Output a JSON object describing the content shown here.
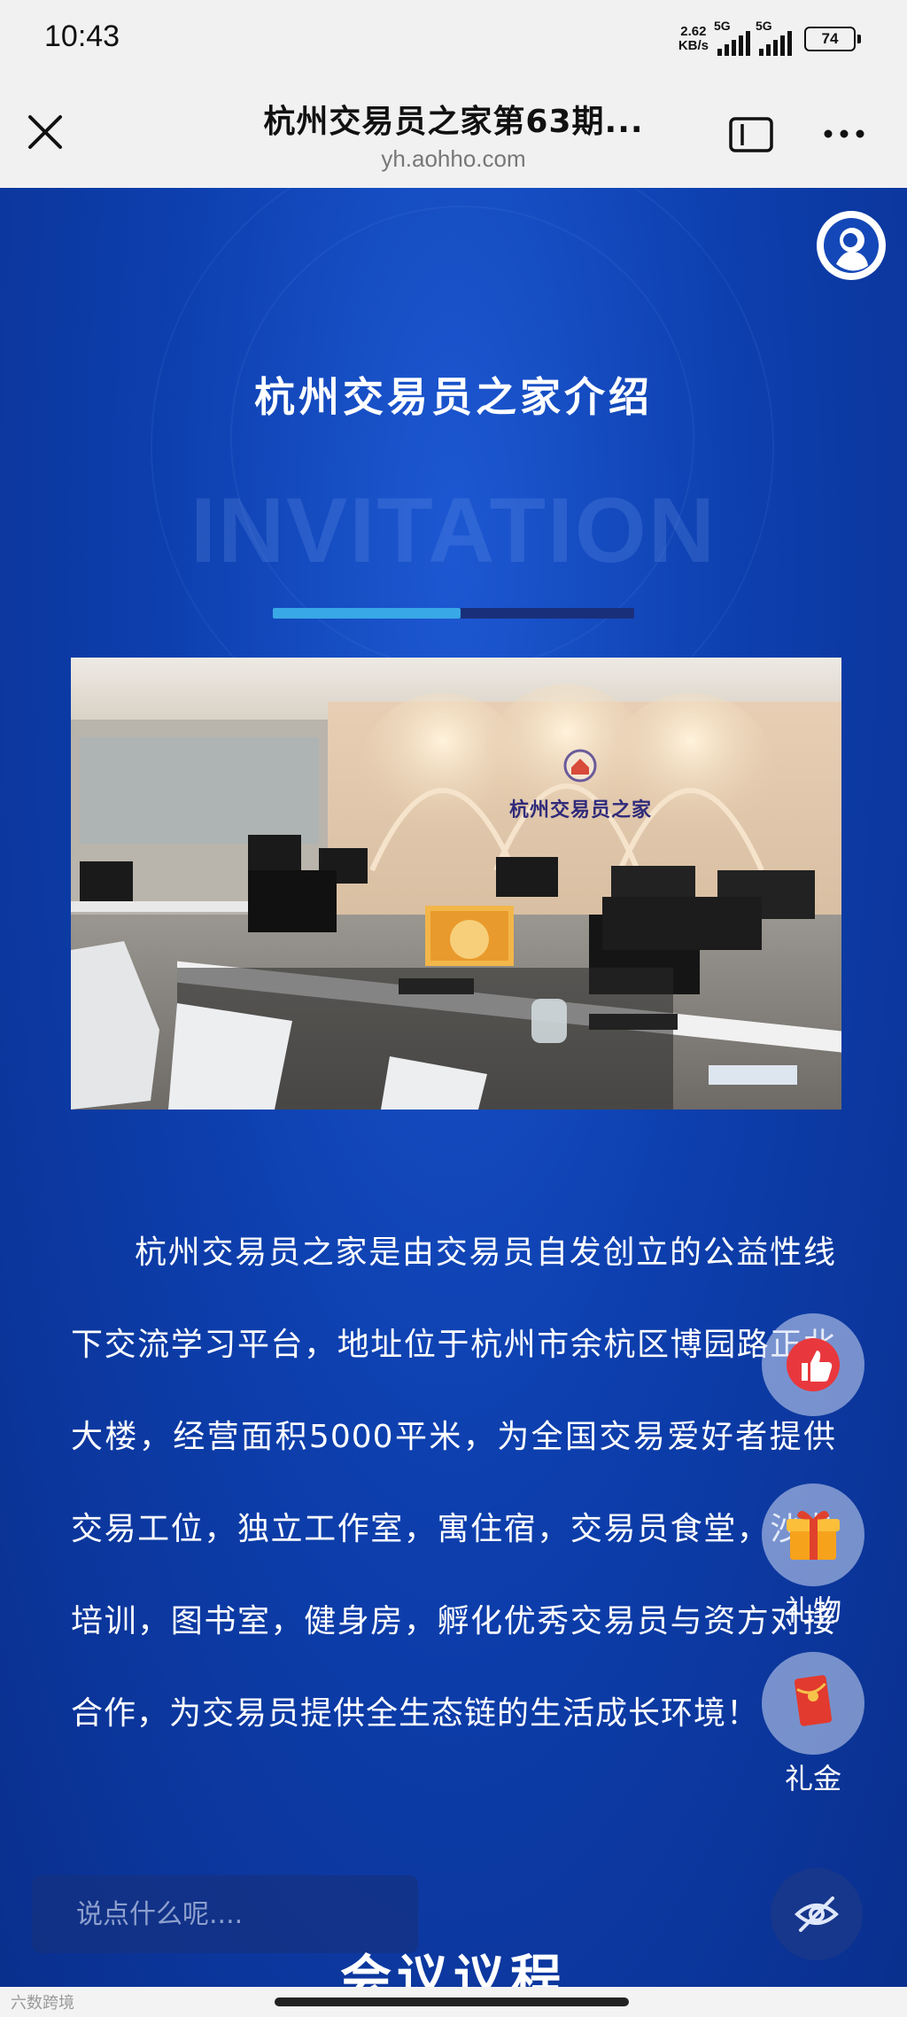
{
  "status_bar": {
    "time": "10:43",
    "speed_value": "2.62",
    "speed_unit": "KB/s",
    "network_1": "5G",
    "network_2": "5G",
    "battery": "74"
  },
  "nav": {
    "title": "杭州交易员之家第63期...",
    "url": "yh.aohho.com"
  },
  "main": {
    "section_title": "杭州交易员之家介绍",
    "watermark": "INVITATION",
    "progress_value": 0.52,
    "photo_sign_text": "杭州交易员之家",
    "intro_text": "杭州交易员之家是由交易员自发创立的公益性线下交流学习平台，地址位于杭州市余杭区博园路正北大楼，经营面积5000平米，为全国交易爱好者提供交易工位，独立工作室，寓住宿，交易员食堂，沙龙培训，图书室，健身房，孵化优秀交易员与资方对接合作，为交易员提供全生态链的生活成长环境！",
    "next_section_title": "会议议程"
  },
  "float_actions": [
    {
      "icon": "thumbs-up-icon",
      "label": ""
    },
    {
      "icon": "gift-icon",
      "label": "礼物"
    },
    {
      "icon": "red-envelope-icon",
      "label": "礼金"
    }
  ],
  "comment": {
    "placeholder": "说点什么呢...."
  },
  "bottom": {
    "watermark": "六数跨境"
  },
  "colors": {
    "page_background": "#0d3fae",
    "progress_fill": "#39a8e6",
    "progress_track": "#1a2f7a",
    "like_red": "#e8383d",
    "gift_orange": "#f7a21b"
  }
}
